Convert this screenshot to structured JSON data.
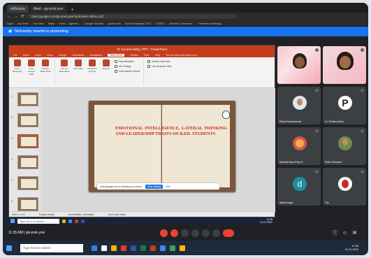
{
  "browser": {
    "tabs": [
      {
        "label": "eWindow",
        "active": false
      },
      {
        "label": "Meet - pjv-jnxk-yvw",
        "active": true
      }
    ],
    "url": "meet.google.com/pjv-jnxk-yvw?authuser=0&hs=122",
    "bookmarks": [
      "Apps",
      "My Drive",
      "YouTube",
      "Maps",
      "Inbox - vignesh...",
      "Google Scholar",
      "gmail.com",
      "Kaveri Holidays 2017",
      "TNTRC",
      "Internet Connectio...",
      "Reference Manag..."
    ]
  },
  "meet": {
    "presenting_text": "Nishanthy shanthi is presenting",
    "time_label": "11:35 AM",
    "meeting_code": "pjv-jnxk-yvw",
    "participants": [
      {
        "name": "",
        "camera": true
      },
      {
        "name": "",
        "camera": true
      },
      {
        "name": "Ravul Mohankumar",
        "avatar_letter": ""
      },
      {
        "name": "Dr. Punitha Mary",
        "avatar_letter": "P"
      },
      {
        "name": "Michael Jeya Priya S",
        "avatar_letter": ""
      },
      {
        "name": "Sofia Selvarani",
        "avatar_letter": ""
      },
      {
        "name": "daniel singh",
        "avatar_letter": "d"
      },
      {
        "name": "You",
        "avatar_letter": ""
      }
    ]
  },
  "powerpoint": {
    "title": "Tri-socieal Ability .PPT - PowerPoint",
    "ribbon_tabs": [
      "File",
      "Home",
      "Insert",
      "Draw",
      "Design",
      "Transitions",
      "Animations",
      "Slide Show",
      "Review",
      "View",
      "Help",
      "Tell me what you want to do"
    ],
    "selected_tab": "Slide Show",
    "ribbon_buttons": [
      "From Beginning",
      "From Current Slide",
      "Custom Slide Show",
      "Set Up Slide Show",
      "Hide Slide",
      "Rehearse Timings",
      "Record"
    ],
    "checkboxes": [
      "Play Narrations",
      "Use Timings",
      "Show Media Controls",
      "Monitor: Automatic",
      "Use Presenter View"
    ],
    "slide_title": "EMOTIONAL INTELLIGENCE, LATERAL THINKING AND LEADERSHIP TRAITS OF B.Ed. STUDENTS",
    "share_bar": {
      "message": "meet.google.com is sharing your screen.",
      "stop": "Stop sharing",
      "hide": "Hide"
    },
    "status": {
      "slide": "Slide 1 of 21",
      "language": "English (India)",
      "accessibility": "Accessibility: Investigate",
      "notes_hint": "Tap to add notes"
    }
  },
  "taskbar": {
    "search_placeholder": "Type here to search",
    "inner_time": "11:35",
    "inner_date": "21-01-2022",
    "time": "11:35",
    "date": "21-01-2022"
  }
}
